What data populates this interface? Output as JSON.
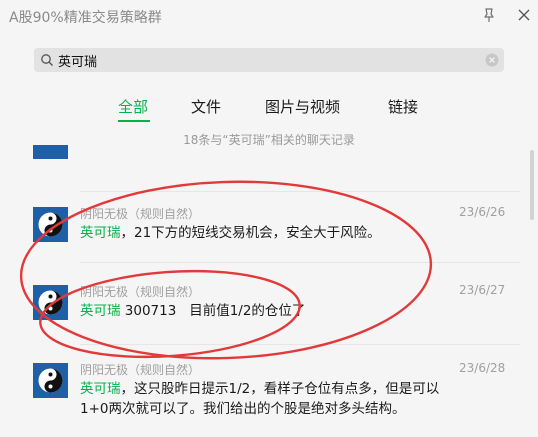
{
  "window": {
    "title": "A股90%精准交易策略群"
  },
  "search": {
    "query": "英可瑞"
  },
  "tabs": [
    {
      "label": "全部",
      "active": true
    },
    {
      "label": "文件",
      "active": false
    },
    {
      "label": "图片与视频",
      "active": false
    },
    {
      "label": "链接",
      "active": false
    }
  ],
  "result_count": "18条与“英可瑞”相关的聊天记录",
  "messages": [
    {
      "sender": "阴阳无极（规则自然）",
      "date": "23/6/26",
      "keyword": "英可瑞",
      "text": "，21下方的短线交易机会，安全大于风险。",
      "avatar_icon": "yin-yang-icon"
    },
    {
      "sender": "阴阳无极（规则自然）",
      "date": "23/6/27",
      "keyword": "英可瑞",
      "text": " 300713   目前值1/2的仓位了",
      "avatar_icon": "yin-yang-icon"
    },
    {
      "sender": "阴阳无极（规则自然）",
      "date": "23/6/28",
      "keyword": "英可瑞",
      "text": "，这只股昨日提示1/2，看样子仓位有点多，但是可以1+0两次就可以了。我们给出的个股是绝对多头结构。",
      "avatar_icon": "yin-yang-icon"
    }
  ],
  "colors": {
    "accent": "#07b14b",
    "annotation": "#e23a3a",
    "avatar_bg": "#1e5fa8"
  }
}
